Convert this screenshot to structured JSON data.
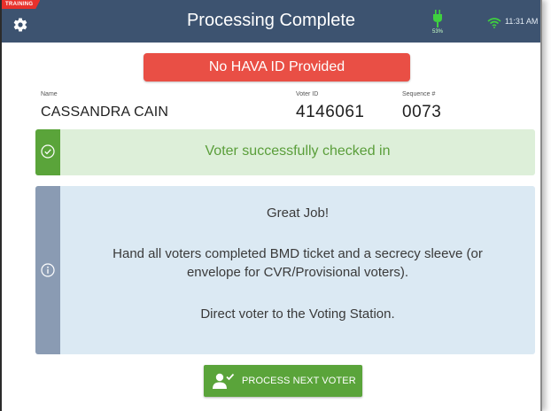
{
  "colors": {
    "topbar": "#3d5370",
    "training_badge": "#e8312b",
    "alert": "#e94f45",
    "success": "#5aa43a",
    "success_bg": "#ddefd9",
    "info_stripe": "#8a9bb3",
    "info_bg": "#dbe9f3"
  },
  "header": {
    "training_badge": "TRAINING",
    "title": "Processing Complete",
    "settings_icon": "gear-icon",
    "battery_icon": "battery-plug-icon",
    "battery_percent": "53%",
    "wifi_icon": "wifi-icon",
    "time": "11:31 AM"
  },
  "alert": {
    "text": "No HAVA ID Provided"
  },
  "voter": {
    "name_label": "Name",
    "name": "CASSANDRA CAIN",
    "voter_id_label": "Voter ID",
    "voter_id": "4146061",
    "sequence_label": "Sequence #",
    "sequence": "0073"
  },
  "success": {
    "icon": "check-circle-icon",
    "message": "Voter successfully checked in"
  },
  "info": {
    "icon": "info-circle-icon",
    "heading": "Great Job!",
    "line1": "Hand all voters completed BMD ticket and a secrecy sleeve (or",
    "line2": "envelope for CVR/Provisional voters).",
    "line3": "Direct voter to the Voting Station."
  },
  "next_button": {
    "icon": "user-check-icon",
    "label": "PROCESS NEXT VOTER"
  }
}
